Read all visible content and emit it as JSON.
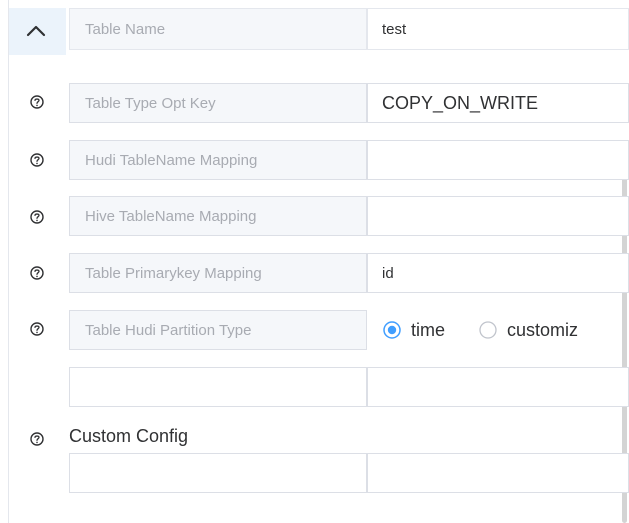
{
  "header": {
    "collapse_icon": "chevron-up-icon",
    "label": "Table Name",
    "value": "test"
  },
  "rows": [
    {
      "label": "Table Type Opt Key",
      "value": "COPY_ON_WRITE",
      "help_icon": "question-circle-icon"
    },
    {
      "label": "Hudi TableName Mapping",
      "value": "",
      "help_icon": "question-circle-icon"
    },
    {
      "label": "Hive TableName Mapping",
      "value": "",
      "help_icon": "question-circle-icon"
    },
    {
      "label": "Table Primarykey Mapping",
      "value": "id",
      "help_icon": "question-circle-icon"
    }
  ],
  "partition": {
    "label": "Table Hudi Partition Type",
    "help_icon": "question-circle-icon",
    "options": [
      {
        "label": "time",
        "selected": true
      },
      {
        "label": "customiz",
        "selected": false
      }
    ]
  },
  "extra_row": {
    "key": "",
    "value": ""
  },
  "custom_config": {
    "label": "Custom Config",
    "help_icon": "question-circle-icon",
    "key": "",
    "value": ""
  },
  "colors": {
    "accent": "#409eff",
    "border": "#dcdfe6",
    "label_bg": "#f5f7fa",
    "label_text": "#a8abb2",
    "header_bg": "#ebf3fb"
  }
}
